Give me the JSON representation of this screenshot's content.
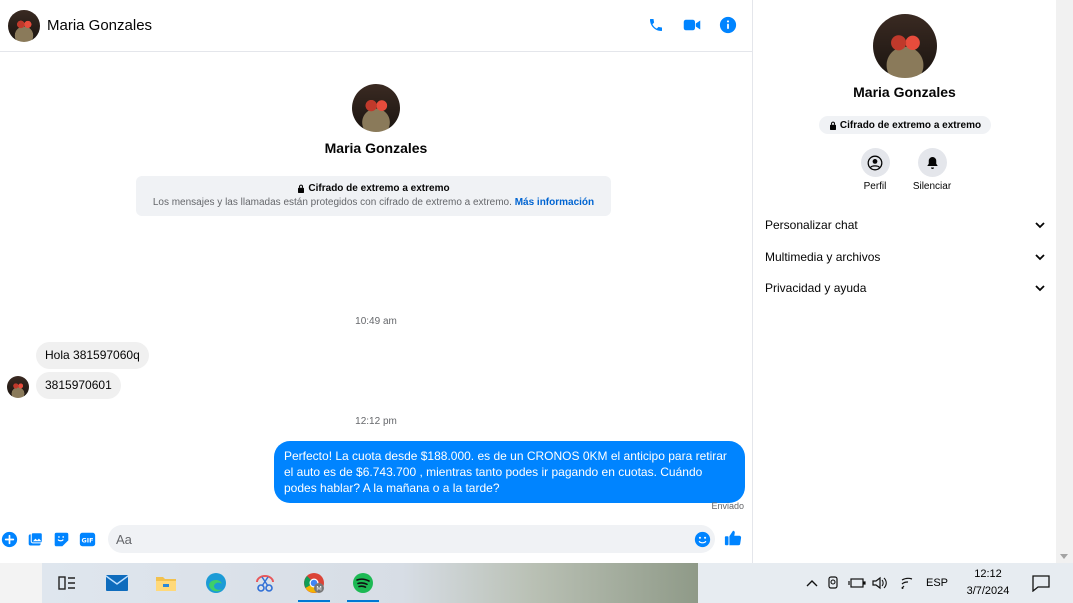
{
  "header": {
    "contact_name": "Maria Gonzales"
  },
  "intro": {
    "contact_name": "Maria Gonzales",
    "e2e_title": "Cifrado de extremo a extremo",
    "e2e_desc": "Los mensajes y las llamadas están protegidos con cifrado de extremo a extremo.",
    "e2e_link": "Más información"
  },
  "messages": {
    "time1": "10:49 am",
    "in1": "Hola 381597060q",
    "in2": "3815970601",
    "time2": "12:12 pm",
    "out1": "Perfecto! La cuota desde $188.000. es de un CRONOS 0KM el anticipo para retirar el auto es de $6.743.700 , mientras tanto podes ir pagando en cuotas. Cuándo podes hablar? A la mañana o a la tarde?",
    "status": "Enviado"
  },
  "composer": {
    "placeholder": "Aa"
  },
  "panel": {
    "contact_name": "Maria Gonzales",
    "e2e_badge": "Cifrado de extremo a extremo",
    "actions": [
      {
        "label": "Perfil"
      },
      {
        "label": "Silenciar"
      }
    ],
    "sections": [
      {
        "label": "Personalizar chat"
      },
      {
        "label": "Multimedia y archivos"
      },
      {
        "label": "Privacidad y ayuda"
      }
    ]
  },
  "taskbar": {
    "language": "ESP",
    "time": "12:12",
    "date": "3/7/2024"
  },
  "colors": {
    "accent": "#0084ff",
    "link": "#0064d1",
    "muted": "#65676b"
  }
}
